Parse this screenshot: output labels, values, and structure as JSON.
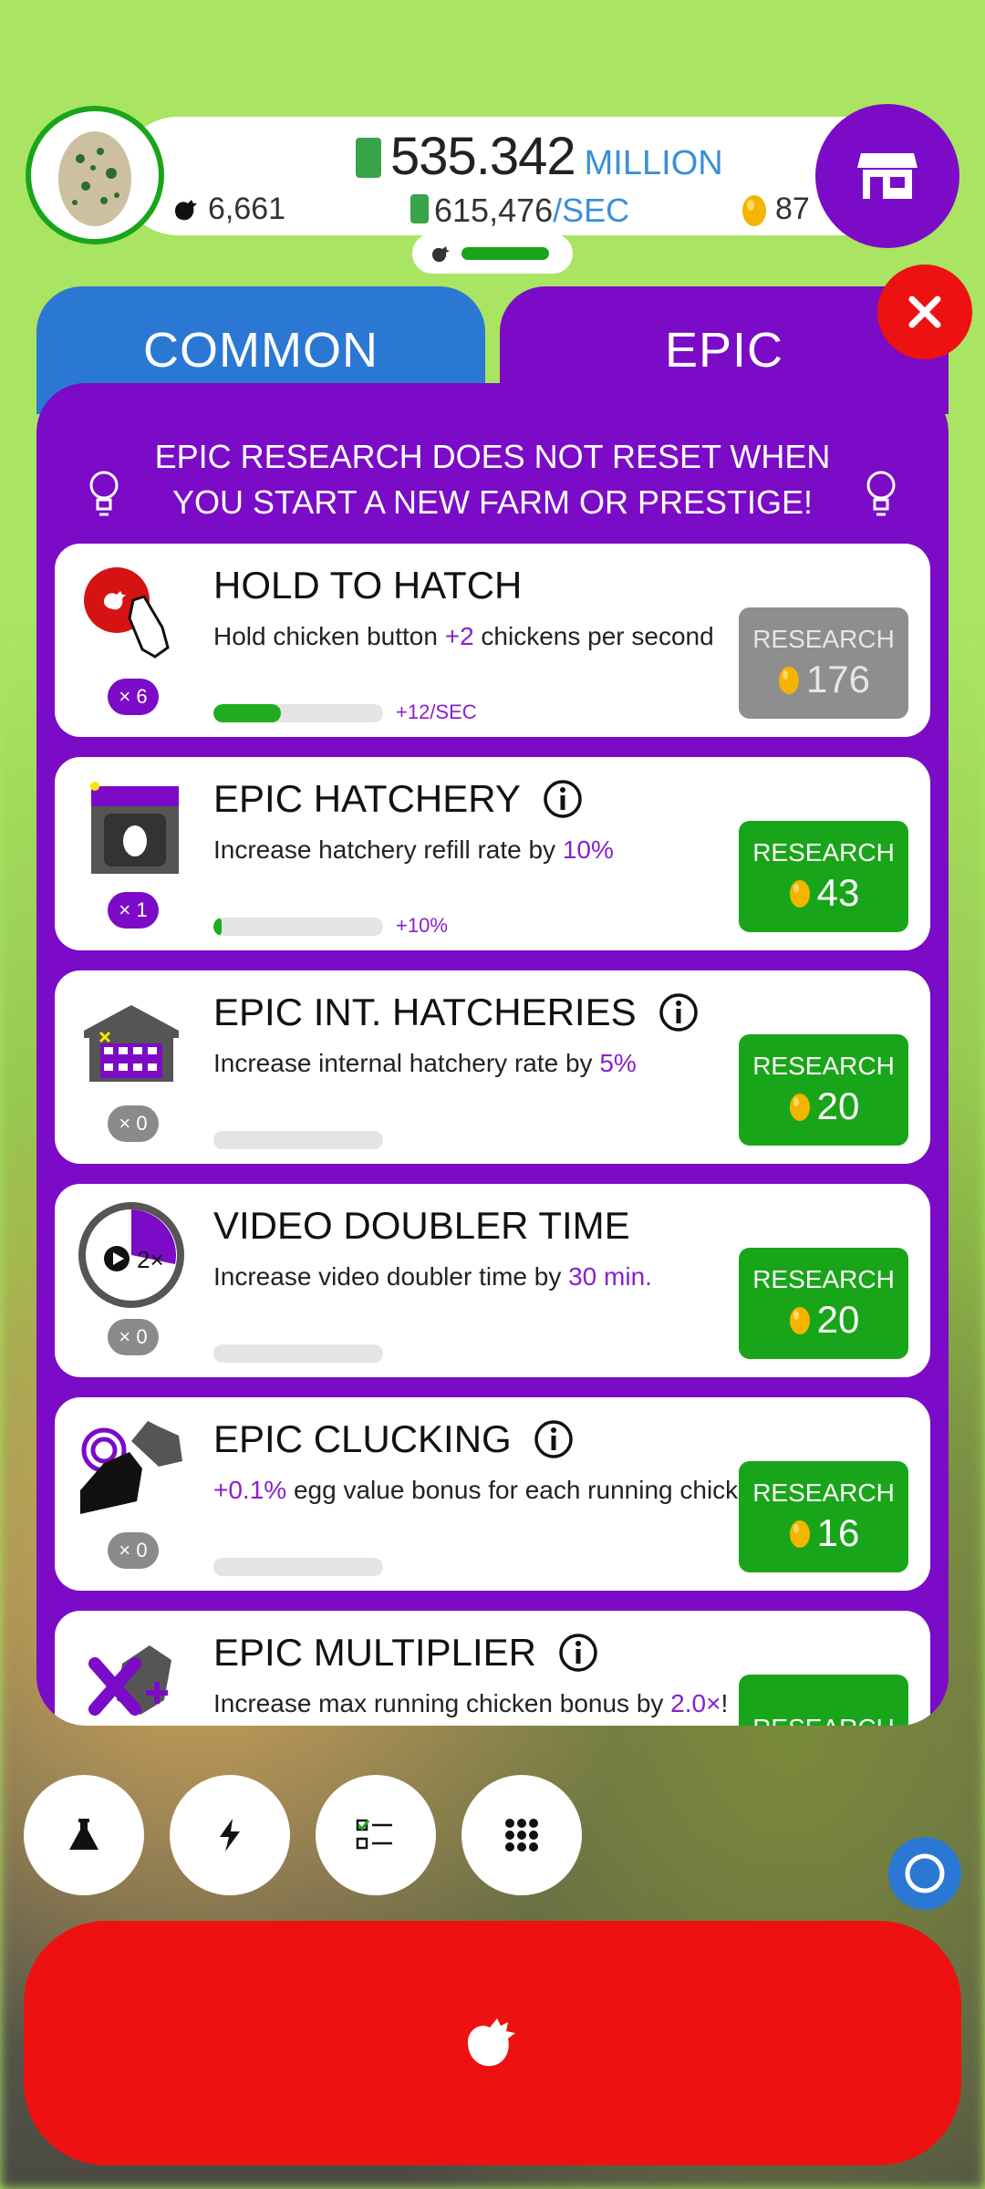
{
  "header": {
    "money_amount": "535.342",
    "money_unit": "MILLION",
    "rate_value": "615,476",
    "rate_unit": "/SEC",
    "chicken_count": "6,661",
    "golden_eggs": "87"
  },
  "tabs": [
    {
      "label": "COMMON",
      "active": false
    },
    {
      "label": "EPIC",
      "active": true
    }
  ],
  "banner": {
    "text": "EPIC RESEARCH DOES NOT RESET WHEN YOU START A NEW FARM OR PRESTIGE!"
  },
  "research": [
    {
      "title": "HOLD TO HATCH",
      "desc_pre": "Hold chicken button ",
      "desc_hl": "+2",
      "desc_post": " chickens per second",
      "badge": "× 6",
      "level_fraction": 0.4,
      "progress_label": "+12/SEC",
      "button_label": "RESEARCH",
      "cost": "176",
      "affordable": false,
      "icon": "hold-hatch-icon",
      "has_info": false
    },
    {
      "title": "EPIC HATCHERY",
      "desc_pre": "Increase hatchery refill rate by ",
      "desc_hl": "10%",
      "desc_post": "",
      "badge": "× 1",
      "level_fraction": 0.05,
      "progress_label": "+10%",
      "button_label": "RESEARCH",
      "cost": "43",
      "affordable": true,
      "icon": "hatchery-icon",
      "has_info": true
    },
    {
      "title": "EPIC INT. HATCHERIES",
      "desc_pre": "Increase internal hatchery rate by ",
      "desc_hl": "5%",
      "desc_post": "",
      "badge": "× 0",
      "level_fraction": 0,
      "progress_label": "",
      "button_label": "RESEARCH",
      "cost": "20",
      "affordable": true,
      "icon": "internal-hatchery-icon",
      "has_info": true
    },
    {
      "title": "VIDEO DOUBLER TIME",
      "desc_pre": "Increase video doubler time by ",
      "desc_hl": "30 min.",
      "desc_post": "",
      "badge": "× 0",
      "level_fraction": 0,
      "progress_label": "",
      "button_label": "RESEARCH",
      "cost": "20",
      "affordable": true,
      "icon": "clock-icon",
      "has_info": false
    },
    {
      "title": "EPIC CLUCKING",
      "desc_pre": "",
      "desc_hl": "+0.1%",
      "desc_post": " egg value bonus for each running chicken.",
      "badge": "× 0",
      "level_fraction": 0,
      "progress_label": "",
      "button_label": "RESEARCH",
      "cost": "16",
      "affordable": true,
      "icon": "clucking-icon",
      "has_info": true
    },
    {
      "title": "EPIC MULTIPLIER",
      "desc_pre": "Increase max running chicken bonus by ",
      "desc_hl": "2.0×",
      "desc_post": "!",
      "badge": "",
      "level_fraction": 0,
      "progress_label": "",
      "button_label": "RESEARCH",
      "cost": "",
      "affordable": true,
      "icon": "multiplier-icon",
      "has_info": true
    }
  ],
  "colors": {
    "background": "#a9e462",
    "purple": "#7b0bc7",
    "blue": "#2b78d4",
    "green": "#19a51a",
    "red": "#ee1111"
  }
}
